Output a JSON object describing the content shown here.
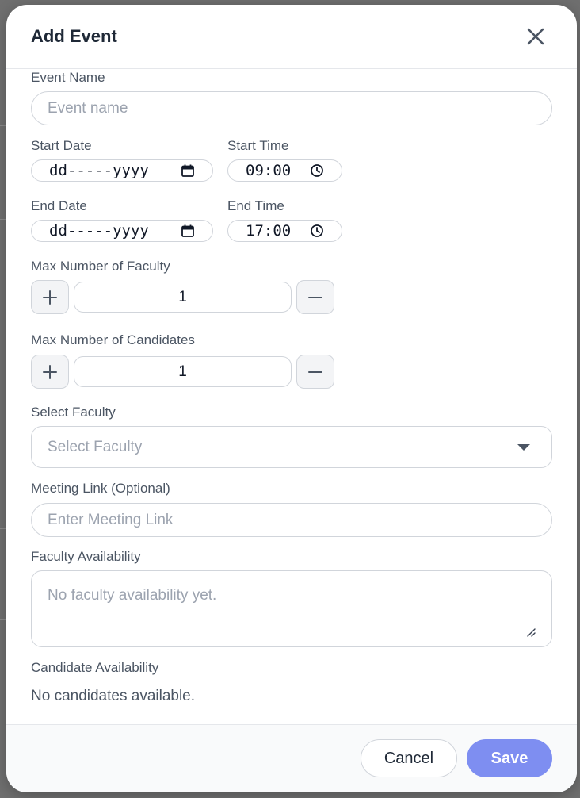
{
  "modal": {
    "title": "Add Event",
    "close_icon": "close-icon"
  },
  "event_name": {
    "label": "Event Name",
    "placeholder": "Event name",
    "value": ""
  },
  "start_date": {
    "label": "Start Date",
    "value": "dd-----yyyy",
    "icon": "calendar-icon"
  },
  "start_time": {
    "label": "Start Time",
    "value": "09:00",
    "icon": "clock-icon"
  },
  "end_date": {
    "label": "End Date",
    "value": "dd-----yyyy",
    "icon": "calendar-icon"
  },
  "end_time": {
    "label": "End Time",
    "value": "17:00",
    "icon": "clock-icon"
  },
  "max_faculty": {
    "label": "Max Number of Faculty",
    "value": "1",
    "increment_icon": "plus-icon",
    "decrement_icon": "minus-icon"
  },
  "max_candidates": {
    "label": "Max Number of Candidates",
    "value": "1",
    "increment_icon": "plus-icon",
    "decrement_icon": "minus-icon"
  },
  "select_faculty": {
    "label": "Select Faculty",
    "placeholder": "Select Faculty",
    "icon": "caret-down-icon"
  },
  "meeting_link": {
    "label": "Meeting Link (Optional)",
    "placeholder": "Enter Meeting Link",
    "value": ""
  },
  "faculty_availability": {
    "label": "Faculty Availability",
    "placeholder": "No faculty availability yet."
  },
  "candidate_availability": {
    "label": "Candidate Availability",
    "empty_text": "No candidates available."
  },
  "footer": {
    "cancel_label": "Cancel",
    "save_label": "Save"
  },
  "colors": {
    "primary": "#7e8ef1",
    "label": "#4b5563",
    "border": "#d1d5db",
    "title": "#1f2937"
  }
}
